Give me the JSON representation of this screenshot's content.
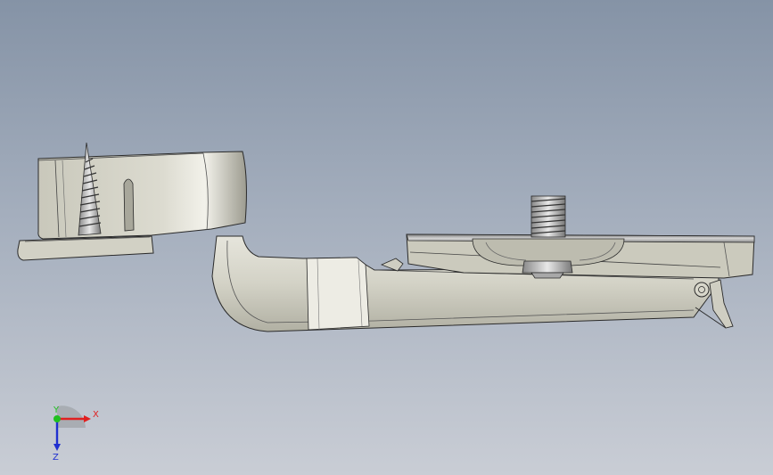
{
  "viewport": {
    "background_top": "#8593a6",
    "background_bottom": "#c9cdd5"
  },
  "model": {
    "part_fill": "#d9d8cc",
    "part_shade": "#b9b8ab",
    "edge_color": "#2a2a2a",
    "metal_fill": "#c8c8c8"
  },
  "triad": {
    "x_label": "X",
    "y_label": "Y",
    "z_label": "Z",
    "x_color": "#e02020",
    "y_color": "#20c020",
    "z_color": "#2030d0"
  }
}
